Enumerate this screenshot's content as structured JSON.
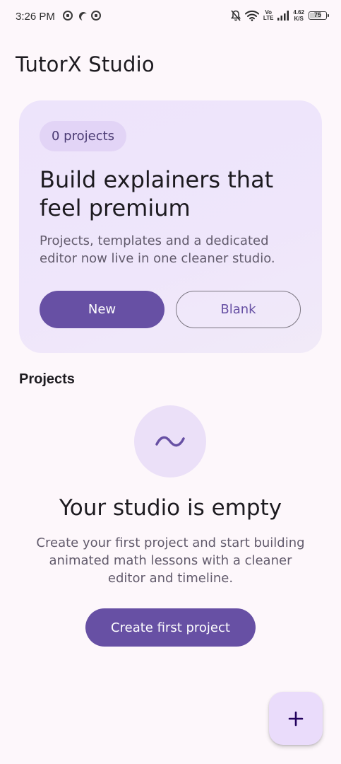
{
  "status_bar": {
    "time": "3:26 PM",
    "left_icons": [
      "notification-app-icon",
      "moon-icon",
      "notification-app-icon"
    ],
    "right_icons": [
      "mute-icon",
      "wifi-icon",
      "volte-icon",
      "signal-icon",
      "battery-icon"
    ],
    "lte_top": "Vo",
    "lte_bottom": "LTE",
    "speed_value": "4.62",
    "speed_unit": "K/S",
    "battery_level": "75"
  },
  "app": {
    "title": "TutorX Studio"
  },
  "hero": {
    "chip_label": "0 projects",
    "heading": "Build explainers that feel premium",
    "description": "Projects, templates and a dedicated editor now live in one cleaner studio.",
    "new_button_label": "New",
    "blank_button_label": "Blank"
  },
  "projects": {
    "section_title": "Projects",
    "empty_icon": "wave-icon",
    "empty_title": "Your studio is empty",
    "empty_description": "Create your first project and start building animated math lessons with a cleaner editor and timeline.",
    "create_button_label": "Create first project"
  },
  "fab": {
    "icon": "plus-icon"
  },
  "colors": {
    "primary": "#6750a4",
    "background": "#fdf7fb",
    "hero_card": "#ede4fb",
    "chip": "#e2d4f6",
    "fab": "#eadcfb",
    "text_primary": "#1d1b20",
    "text_secondary": "#625b6c"
  }
}
